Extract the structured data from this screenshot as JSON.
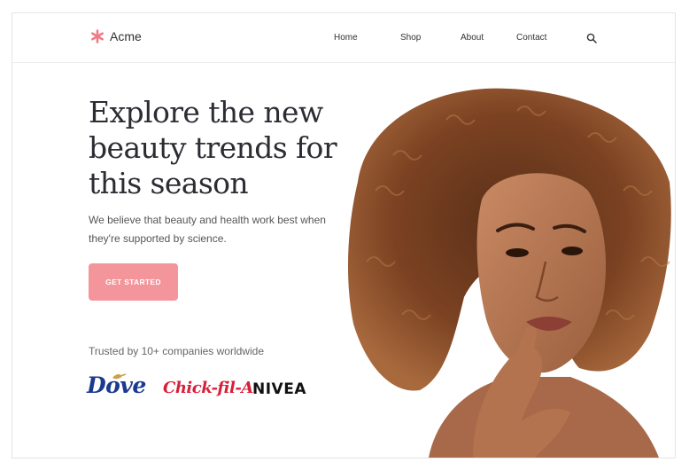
{
  "brand": {
    "name": "Acme",
    "icon": "asterisk-icon",
    "color": "#f07a86"
  },
  "nav": {
    "links": [
      {
        "label": "Home"
      },
      {
        "label": "Shop"
      },
      {
        "label": "About"
      },
      {
        "label": "Contact"
      }
    ],
    "search_icon": "search-icon"
  },
  "hero": {
    "title": "Explore the new beauty trends for this season",
    "description": "We believe that beauty and health work best when they're supported by science.",
    "cta_label": "GET STARTED",
    "cta_color": "#f3959a",
    "image": "woman-portrait"
  },
  "trusted": {
    "text": "Trusted by 10+ companies worldwide",
    "logos": [
      {
        "name": "Dove",
        "color": "#1a3a8f"
      },
      {
        "name": "Chick-fil-A",
        "color": "#d81f3a"
      },
      {
        "name": "NIVEA",
        "color": "#111111"
      }
    ]
  }
}
